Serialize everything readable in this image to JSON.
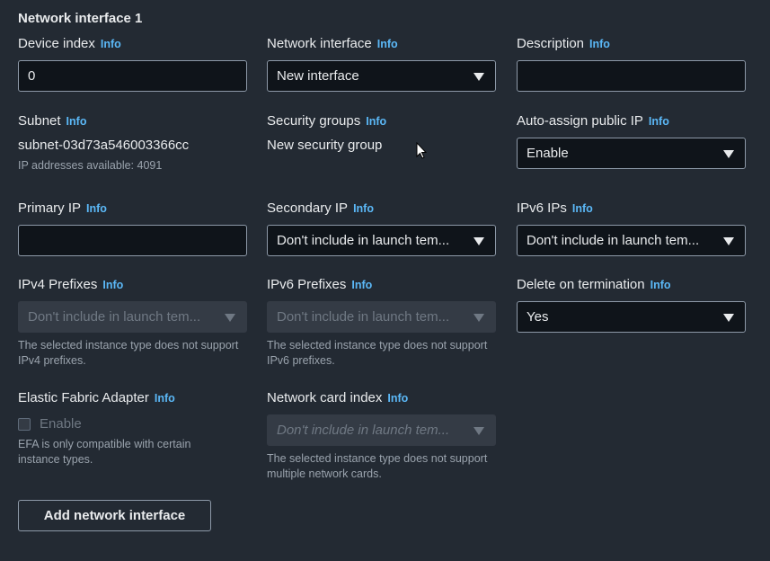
{
  "section_title": "Network interface 1",
  "info_label": "Info",
  "fields": {
    "device_index": {
      "label": "Device index",
      "value": "0"
    },
    "network_interface": {
      "label": "Network interface",
      "value": "New interface"
    },
    "description": {
      "label": "Description",
      "value": ""
    },
    "subnet": {
      "label": "Subnet",
      "value": "subnet-03d73a546003366cc",
      "hint": "IP addresses available: 4091"
    },
    "security_groups": {
      "label": "Security groups",
      "value": "New security group"
    },
    "auto_assign_ip": {
      "label": "Auto-assign public IP",
      "value": "Enable"
    },
    "primary_ip": {
      "label": "Primary IP",
      "value": ""
    },
    "secondary_ip": {
      "label": "Secondary IP",
      "value": "Don't include in launch tem..."
    },
    "ipv6_ips": {
      "label": "IPv6 IPs",
      "value": "Don't include in launch tem..."
    },
    "ipv4_prefixes": {
      "label": "IPv4 Prefixes",
      "value": "Don't include in launch tem...",
      "hint": "The selected instance type does not support IPv4 prefixes."
    },
    "ipv6_prefixes": {
      "label": "IPv6 Prefixes",
      "value": "Don't include in launch tem...",
      "hint": "The selected instance type does not support IPv6 prefixes."
    },
    "delete_on_termination": {
      "label": "Delete on termination",
      "value": "Yes"
    },
    "efa": {
      "label": "Elastic Fabric Adapter",
      "checkbox_label": "Enable",
      "checked": false,
      "hint": "EFA is only compatible with certain instance types."
    },
    "network_card_index": {
      "label": "Network card index",
      "value": "Don't include in launch tem...",
      "hint": "The selected instance type does not support multiple network cards."
    }
  },
  "add_button_label": "Add network interface",
  "colors": {
    "background": "#232a33",
    "input_bg": "#0f141a",
    "info_link": "#5bb8f7",
    "border": "#8d99a8"
  }
}
